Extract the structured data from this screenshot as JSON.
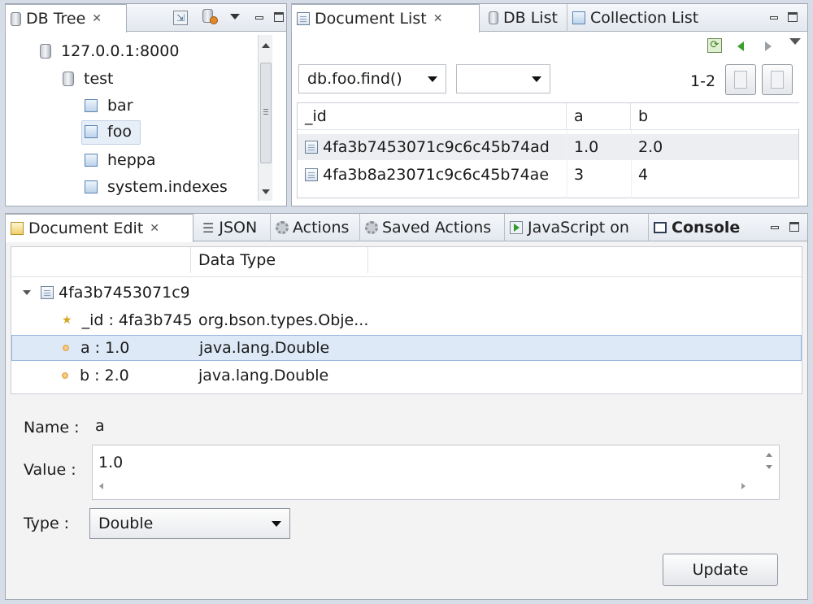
{
  "db_tree": {
    "tab_label": "DB Tree",
    "items": [
      {
        "label": "127.0.0.1:8000"
      },
      {
        "label": "test"
      },
      {
        "label": "bar"
      },
      {
        "label": "foo"
      },
      {
        "label": "heppa"
      },
      {
        "label": "system.indexes"
      }
    ]
  },
  "document_list": {
    "tabs": [
      "Document List",
      "DB List",
      "Collection List"
    ],
    "query": "db.foo.find()",
    "second_select": "",
    "page_range": "1-2",
    "columns": [
      "_id",
      "a",
      "b"
    ],
    "rows": [
      {
        "id": "4fa3b7453071c9c6c45b74ad",
        "a": "1.0",
        "b": "2.0"
      },
      {
        "id": "4fa3b8a23071c9c6c45b74ae",
        "a": "3",
        "b": "4"
      }
    ]
  },
  "document_edit": {
    "tabs": [
      "Document Edit",
      "JSON",
      "Actions",
      "Saved Actions",
      "JavaScript on",
      "Console"
    ],
    "column_header": "Data Type",
    "root": "4fa3b7453071c9",
    "fields": [
      {
        "key": "_id : 4fa3b745",
        "type": "org.bson.types.Obje..."
      },
      {
        "key": "a : 1.0",
        "type": "java.lang.Double"
      },
      {
        "key": "b : 2.0",
        "type": "java.lang.Double"
      }
    ],
    "name_label": "Name :",
    "name_value": "a",
    "value_label": "Value :",
    "value_text": "1.0",
    "type_label": "Type :",
    "type_value": "Double",
    "update_label": "Update"
  }
}
